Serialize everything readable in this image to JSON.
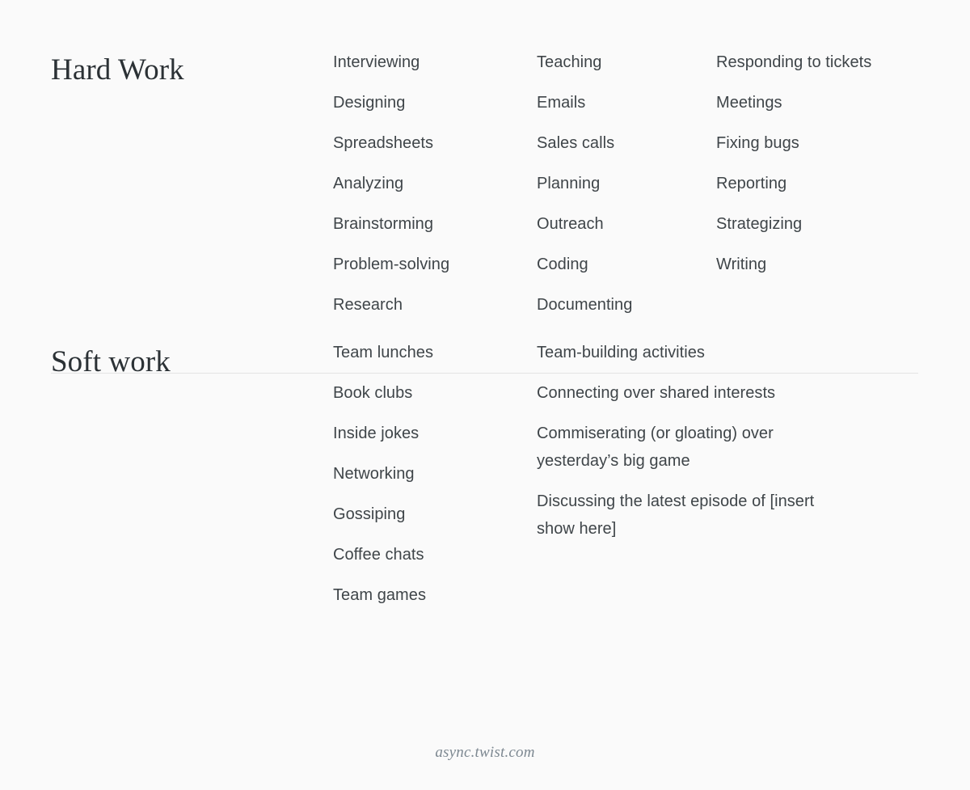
{
  "page": {
    "background_color": "#fafafa",
    "text_color": "#3f4549",
    "heading_color": "#2b3135",
    "divider_color": "#e3e3e3",
    "footer_color": "#7d8891"
  },
  "sections": [
    {
      "id": "hard-work",
      "heading": "Hard Work",
      "columns": [
        {
          "id": "hard-col-1",
          "items": [
            "Interviewing",
            "Designing",
            "Spreadsheets",
            "Analyzing",
            "Brainstorming",
            "Problem-solving",
            "Research"
          ]
        },
        {
          "id": "hard-col-2",
          "items": [
            "Teaching",
            "Emails",
            "Sales calls",
            "Planning",
            "Outreach",
            "Coding",
            "Documenting"
          ]
        },
        {
          "id": "hard-col-3",
          "items": [
            "Responding to tickets",
            "Meetings",
            "Fixing bugs",
            "Reporting",
            "Strategizing",
            "Writing"
          ]
        }
      ]
    },
    {
      "id": "soft-work",
      "heading": "Soft work",
      "columns": [
        {
          "id": "soft-col-1",
          "items": [
            "Team lunches",
            "Book clubs",
            "Inside jokes",
            "Networking",
            "Gossiping",
            "Coffee chats",
            "Team games"
          ]
        },
        {
          "id": "soft-col-2",
          "items": [
            "Team-building activities",
            "Connecting over shared interests",
            "Commiserating (or gloating) over yesterday’s big game",
            "Discussing the latest episode of [insert show here]"
          ]
        }
      ]
    }
  ],
  "footer": {
    "url": "async.twist.com"
  }
}
